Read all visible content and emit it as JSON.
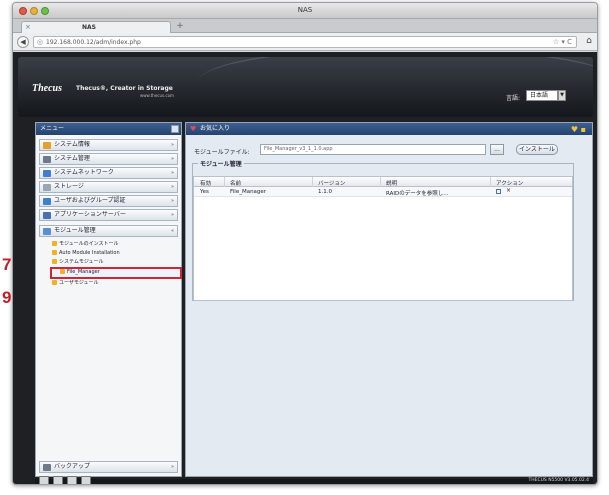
{
  "window": {
    "title": "NAS"
  },
  "tab": {
    "label": "NAS",
    "close": "×",
    "new": "+"
  },
  "nav": {
    "url": "192.168.000.12/adm/index.php",
    "globe": "◎",
    "tools": "☆ ▾ C",
    "home": "⌂",
    "back": "◀"
  },
  "header": {
    "logo": "Thecus",
    "slogan": "Thecus®, Creator in Storage",
    "slogan_url": "www.thecus.com",
    "lang_label": "言語:",
    "lang_value": "日本語"
  },
  "sidebar": {
    "title": "メニュー",
    "categories": [
      {
        "label": "システム情報",
        "color": "#e3a02c"
      },
      {
        "label": "システム管理",
        "color": "#6c7a8a"
      },
      {
        "label": "システムネットワーク",
        "color": "#3e7fcf"
      },
      {
        "label": "ストレージ",
        "color": "#9aa6b3"
      },
      {
        "label": "ユーザおよびグループ認証",
        "color": "#3e7fcf"
      },
      {
        "label": "アプリケーションサーバー",
        "color": "#4a6fb3"
      },
      {
        "label": "モジュール管理",
        "color": "#5a8fd4"
      }
    ],
    "sub_items": [
      "モジュールのインストール",
      "Auto Module Installation",
      "システムモジュール",
      "File_Manager",
      "ユーザモジュール"
    ],
    "footer": "バックアップ"
  },
  "callouts": {
    "first": "7",
    "second": "9"
  },
  "main": {
    "title": "お気に入り",
    "file_label": "モジュールファイル:",
    "file_value": "File_Manager_v3_1_1.0.app",
    "browse": "...",
    "install": "インストール",
    "legend": "モジュール管理",
    "columns": [
      "有効",
      "名前",
      "バージョン",
      "説明",
      "アクション"
    ],
    "rows": [
      {
        "enabled": "Yes",
        "name": "File_Manager",
        "version": "1.1.0",
        "description": "RAIDのデータを参照し...",
        "delete": "×"
      }
    ]
  },
  "footer": {
    "version": "THECUS N5500 V3.05.02.4"
  }
}
